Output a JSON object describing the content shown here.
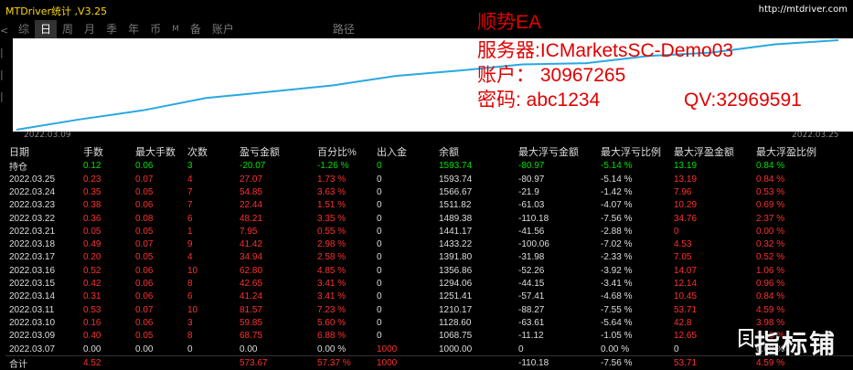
{
  "window": {
    "title": "MTDriver统计 ,V3.25",
    "url": "http://mtdriver.com"
  },
  "tabs": [
    "综",
    "日",
    "周",
    "月",
    "季",
    "年",
    "币",
    "M",
    "备",
    "账户",
    "路径"
  ],
  "active_tab": "日",
  "overlay": {
    "line1": "顺势EA",
    "line2": "服务器:ICMarketsSC-Demo03",
    "line3": "账户：  30967265",
    "line4": "密码: abc1234",
    "qv": "QV:32969591"
  },
  "chart": {
    "start_date": "2022.03.09",
    "end_date": "2022.03.25",
    "line_color": "#29a8e0",
    "equity_points": [
      1000.0,
      1068.75,
      1128.6,
      1210.17,
      1251.41,
      1294.06,
      1356.86,
      1391.8,
      1433.22,
      1441.17,
      1489.38,
      1511.82,
      1566.67,
      1593.74
    ]
  },
  "table": {
    "headers": [
      "日期",
      "手数",
      "最大手数",
      "次数",
      "盈亏金额",
      "百分比%",
      "出入金",
      "余额",
      "最大浮亏金额",
      "最大浮亏比例",
      "最大浮盈金额",
      "最大浮盈比例"
    ],
    "rows": [
      [
        "持仓",
        "0.12",
        "0.06",
        "3",
        "-20.07",
        "-1.26 %",
        "0",
        "1593.74",
        "-80.97",
        "-5.14 %",
        "13.19",
        "0.84 %"
      ],
      [
        "2022.03.25",
        "0.23",
        "0.07",
        "4",
        "27.07",
        "1.73 %",
        "0",
        "1593.74",
        "-80.97",
        "-5.14 %",
        "13.19",
        "0.84 %"
      ],
      [
        "2022.03.24",
        "0.35",
        "0.05",
        "7",
        "54.85",
        "3.63 %",
        "0",
        "1566.67",
        "-21.9",
        "-1.42 %",
        "7.96",
        "0.53 %"
      ],
      [
        "2022.03.23",
        "0.38",
        "0.06",
        "7",
        "22.44",
        "1.51 %",
        "0",
        "1511.82",
        "-61.03",
        "-4.07 %",
        "10.29",
        "0.69 %"
      ],
      [
        "2022.03.22",
        "0.36",
        "0.08",
        "6",
        "48.21",
        "3.35 %",
        "0",
        "1489.38",
        "-110.18",
        "-7.56 %",
        "34.76",
        "2.37 %"
      ],
      [
        "2022.03.21",
        "0.05",
        "0.05",
        "1",
        "7.95",
        "0.55 %",
        "0",
        "1441.17",
        "-41.56",
        "-2.88 %",
        "0",
        "0.00 %"
      ],
      [
        "2022.03.18",
        "0.49",
        "0.07",
        "9",
        "41.42",
        "2.98 %",
        "0",
        "1433.22",
        "-100.06",
        "-7.02 %",
        "4.53",
        "0.32 %"
      ],
      [
        "2022.03.17",
        "0.20",
        "0.05",
        "4",
        "34.94",
        "2.58 %",
        "0",
        "1391.80",
        "-31.98",
        "-2.33 %",
        "7.05",
        "0.52 %"
      ],
      [
        "2022.03.16",
        "0.52",
        "0.06",
        "10",
        "62.80",
        "4.85 %",
        "0",
        "1356.86",
        "-52.26",
        "-3.92 %",
        "14.07",
        "1.06 %"
      ],
      [
        "2022.03.15",
        "0.42",
        "0.06",
        "8",
        "42.65",
        "3.41 %",
        "0",
        "1294.06",
        "-44.15",
        "-3.41 %",
        "12.14",
        "0.96 %"
      ],
      [
        "2022.03.14",
        "0.31",
        "0.06",
        "6",
        "41.24",
        "3.41 %",
        "0",
        "1251.41",
        "-57.41",
        "-4.68 %",
        "10.45",
        "0.84 %"
      ],
      [
        "2022.03.11",
        "0.53",
        "0.07",
        "10",
        "81.57",
        "7.23 %",
        "0",
        "1210.17",
        "-88.27",
        "-7.55 %",
        "53.71",
        "4.59 %"
      ],
      [
        "2022.03.10",
        "0.16",
        "0.06",
        "3",
        "59.85",
        "5.60 %",
        "0",
        "1128.60",
        "-63.61",
        "-5.64 %",
        "42.8",
        "3.98 %"
      ],
      [
        "2022.03.09",
        "0.40",
        "0.05",
        "8",
        "68.75",
        "6.88 %",
        "0",
        "1068.75",
        "-11.12",
        "-1.05 %",
        "12.65",
        "1.18 %"
      ],
      [
        "2022.03.07",
        "0.00",
        "0.00",
        "0",
        "0.00",
        "0.00 %",
        "1000",
        "1000.00",
        "0",
        "0.00 %",
        "0",
        "0.00 %"
      ]
    ],
    "total": [
      "合计",
      "4.52",
      "",
      "",
      "573.67",
      "57.37 %",
      "1000",
      "",
      "-110.18",
      "-7.56 %",
      "53.71",
      "4.59 %"
    ]
  },
  "watermark": "指标铺",
  "colors": {
    "title": "#ffd700",
    "positive": "#ff3030",
    "holding": "#00e000",
    "overlay": "#e00000"
  }
}
